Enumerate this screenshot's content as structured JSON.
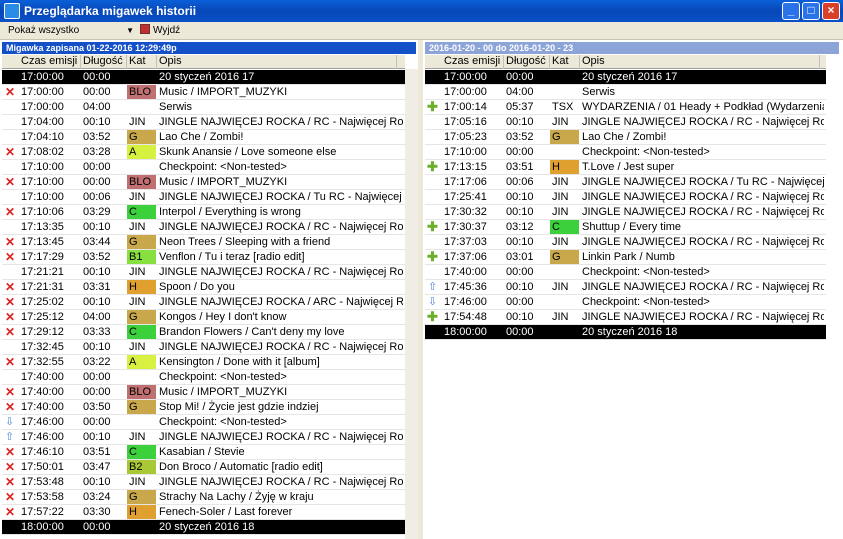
{
  "window": {
    "title": "Przeglądarka migawek historii"
  },
  "toolbar": {
    "filter_value": "Pokaż wszystko",
    "exit_label": "Wyjdź"
  },
  "left": {
    "header": "Migawka zapisana 01-22-2016 12:29:49p",
    "columns": [
      "Czas emisji",
      "Długość",
      "Kat",
      "Opis"
    ],
    "rows": [
      {
        "icon": "",
        "time": "17:00:00",
        "dur": "00:00",
        "cat": "",
        "desc": "20 styczeń 2016 17",
        "dark": true
      },
      {
        "icon": "cross",
        "time": "17:00:00",
        "dur": "00:00",
        "cat": "BLO",
        "catColor": "#c07070",
        "desc": "Music / IMPORT_MUZYKI"
      },
      {
        "icon": "",
        "time": "17:00:00",
        "dur": "04:00",
        "cat": "",
        "desc": "Serwis"
      },
      {
        "icon": "",
        "time": "17:04:00",
        "dur": "00:10",
        "cat": "JIN",
        "desc": "JINGLE NAJWIĘCEJ ROCKA / RC - Najwięcej Rocka w"
      },
      {
        "icon": "",
        "time": "17:04:10",
        "dur": "03:52",
        "cat": "G",
        "catColor": "#c8a84a",
        "desc": "Lao Che / Zombi!"
      },
      {
        "icon": "cross",
        "time": "17:08:02",
        "dur": "03:28",
        "cat": "A",
        "catColor": "#d8f040",
        "desc": "Skunk Anansie / Love someone else"
      },
      {
        "icon": "",
        "time": "17:10:00",
        "dur": "00:00",
        "cat": "",
        "desc": "Checkpoint: <Non-tested>"
      },
      {
        "icon": "cross",
        "time": "17:10:00",
        "dur": "00:00",
        "cat": "BLO",
        "catColor": "#c07070",
        "desc": "Music / IMPORT_MUZYKI"
      },
      {
        "icon": "",
        "time": "17:10:00",
        "dur": "00:06",
        "cat": "JIN",
        "desc": "JINGLE NAJWIĘCEJ ROCKA / Tu RC - Najwięcej Rock"
      },
      {
        "icon": "cross",
        "time": "17:10:06",
        "dur": "03:29",
        "cat": "C",
        "catColor": "#3cd03c",
        "desc": "Interpol / Everything is wrong"
      },
      {
        "icon": "",
        "time": "17:13:35",
        "dur": "00:10",
        "cat": "JIN",
        "desc": "JINGLE NAJWIĘCEJ ROCKA / RC - Najwięcej Rocka w"
      },
      {
        "icon": "cross",
        "time": "17:13:45",
        "dur": "03:44",
        "cat": "G",
        "catColor": "#c8a84a",
        "desc": "Neon Trees / Sleeping with a friend"
      },
      {
        "icon": "cross",
        "time": "17:17:29",
        "dur": "03:52",
        "cat": "B1",
        "catColor": "#88e040",
        "desc": "Venflon / Tu i teraz [radio edit]"
      },
      {
        "icon": "",
        "time": "17:21:21",
        "dur": "00:10",
        "cat": "JIN",
        "desc": "JINGLE NAJWIĘCEJ ROCKA / RC - Najwięcej Rocka w"
      },
      {
        "icon": "cross",
        "time": "17:21:31",
        "dur": "03:31",
        "cat": "H",
        "catColor": "#e0a030",
        "desc": "Spoon / Do you"
      },
      {
        "icon": "cross",
        "time": "17:25:02",
        "dur": "00:10",
        "cat": "JIN",
        "desc": "JINGLE NAJWIĘCEJ ROCKA / ARC - Najwięcej Rocka"
      },
      {
        "icon": "cross",
        "time": "17:25:12",
        "dur": "04:00",
        "cat": "G",
        "catColor": "#c8a84a",
        "desc": "Kongos / Hey I don't know"
      },
      {
        "icon": "cross",
        "time": "17:29:12",
        "dur": "03:33",
        "cat": "C",
        "catColor": "#3cd03c",
        "desc": "Brandon Flowers / Can't deny my love"
      },
      {
        "icon": "",
        "time": "17:32:45",
        "dur": "00:10",
        "cat": "JIN",
        "desc": "JINGLE NAJWIĘCEJ ROCKA / RC - Najwięcej Rocka w"
      },
      {
        "icon": "cross",
        "time": "17:32:55",
        "dur": "03:22",
        "cat": "A",
        "catColor": "#d8f040",
        "desc": "Kensington / Done with it [album]"
      },
      {
        "icon": "",
        "time": "17:40:00",
        "dur": "00:00",
        "cat": "",
        "desc": "Checkpoint: <Non-tested>"
      },
      {
        "icon": "cross",
        "time": "17:40:00",
        "dur": "00:00",
        "cat": "BLO",
        "catColor": "#c07070",
        "desc": "Music / IMPORT_MUZYKI"
      },
      {
        "icon": "cross",
        "time": "17:40:00",
        "dur": "03:50",
        "cat": "G",
        "catColor": "#c8a84a",
        "desc": "Stop Mi! / Życie jest gdzie indziej"
      },
      {
        "icon": "down",
        "time": "17:46:00",
        "dur": "00:00",
        "cat": "",
        "desc": "Checkpoint: <Non-tested>"
      },
      {
        "icon": "up",
        "time": "17:46:00",
        "dur": "00:10",
        "cat": "JIN",
        "desc": "JINGLE NAJWIĘCEJ ROCKA / RC - Najwięcej Rocka w"
      },
      {
        "icon": "cross",
        "time": "17:46:10",
        "dur": "03:51",
        "cat": "C",
        "catColor": "#3cd03c",
        "desc": "Kasabian / Stevie"
      },
      {
        "icon": "cross",
        "time": "17:50:01",
        "dur": "03:47",
        "cat": "B2",
        "catColor": "#a8c838",
        "desc": "Don Broco / Automatic [radio edit]"
      },
      {
        "icon": "cross",
        "time": "17:53:48",
        "dur": "00:10",
        "cat": "JIN",
        "desc": "JINGLE NAJWIĘCEJ ROCKA / RC - Najwięcej Rocka w"
      },
      {
        "icon": "cross",
        "time": "17:53:58",
        "dur": "03:24",
        "cat": "G",
        "catColor": "#c8a84a",
        "desc": "Strachy Na Lachy / Żyję w kraju"
      },
      {
        "icon": "cross",
        "time": "17:57:22",
        "dur": "03:30",
        "cat": "H",
        "catColor": "#e0a030",
        "desc": "Fenech-Soler / Last forever"
      },
      {
        "icon": "",
        "time": "18:00:00",
        "dur": "00:00",
        "cat": "",
        "desc": "20 styczeń 2016 18",
        "dark": true
      }
    ]
  },
  "right": {
    "header": "2016-01-20 - 00 do 2016-01-20 - 23",
    "columns": [
      "Czas emisji",
      "Długość",
      "Kat",
      "Opis"
    ],
    "rows": [
      {
        "icon": "",
        "time": "17:00:00",
        "dur": "00:00",
        "cat": "",
        "desc": "20 styczeń 2016 17",
        "dark": true
      },
      {
        "icon": "",
        "time": "17:00:00",
        "dur": "04:00",
        "cat": "",
        "desc": "Serwis"
      },
      {
        "icon": "plus",
        "time": "17:00:14",
        "dur": "05:37",
        "cat": "TSX",
        "desc": "WYDARZENIA / 01 Heady + Podkład (Wydarzenia)"
      },
      {
        "icon": "",
        "time": "17:05:16",
        "dur": "00:10",
        "cat": "JIN",
        "desc": "JINGLE NAJWIĘCEJ ROCKA / RC - Najwięcej Rocka w"
      },
      {
        "icon": "",
        "time": "17:05:23",
        "dur": "03:52",
        "cat": "G",
        "catColor": "#c8a84a",
        "desc": "Lao Che / Zombi!"
      },
      {
        "icon": "",
        "time": "17:10:00",
        "dur": "00:00",
        "cat": "",
        "desc": "Checkpoint: <Non-tested>"
      },
      {
        "icon": "plus",
        "time": "17:13:15",
        "dur": "03:51",
        "cat": "H",
        "catColor": "#e0a030",
        "desc": "T.Love / Jest super"
      },
      {
        "icon": "",
        "time": "17:17:06",
        "dur": "00:06",
        "cat": "JIN",
        "desc": "JINGLE NAJWIĘCEJ ROCKA / Tu RC - Najwięcej Rock"
      },
      {
        "icon": "",
        "time": "17:25:41",
        "dur": "00:10",
        "cat": "JIN",
        "desc": "JINGLE NAJWIĘCEJ ROCKA / RC - Najwięcej Rocka w"
      },
      {
        "icon": "",
        "time": "17:30:32",
        "dur": "00:10",
        "cat": "JIN",
        "desc": "JINGLE NAJWIĘCEJ ROCKA / RC - Najwięcej Rocka w"
      },
      {
        "icon": "plus",
        "time": "17:30:37",
        "dur": "03:12",
        "cat": "C",
        "catColor": "#3cd03c",
        "desc": "Shuttup / Every time"
      },
      {
        "icon": "",
        "time": "17:37:03",
        "dur": "00:10",
        "cat": "JIN",
        "desc": "JINGLE NAJWIĘCEJ ROCKA / RC - Najwięcej Rocka w"
      },
      {
        "icon": "plus",
        "time": "17:37:06",
        "dur": "03:01",
        "cat": "G",
        "catColor": "#c8a84a",
        "desc": "Linkin Park / Numb"
      },
      {
        "icon": "",
        "time": "17:40:00",
        "dur": "00:00",
        "cat": "",
        "desc": "Checkpoint: <Non-tested>"
      },
      {
        "icon": "up",
        "time": "17:45:36",
        "dur": "00:10",
        "cat": "JIN",
        "desc": "JINGLE NAJWIĘCEJ ROCKA / RC - Najwięcej Rocka w"
      },
      {
        "icon": "down",
        "time": "17:46:00",
        "dur": "00:00",
        "cat": "",
        "desc": "Checkpoint: <Non-tested>"
      },
      {
        "icon": "plus",
        "time": "17:54:48",
        "dur": "00:10",
        "cat": "JIN",
        "desc": "JINGLE NAJWIĘCEJ ROCKA / RC - Najwięcej Rocka w"
      },
      {
        "icon": "",
        "time": "18:00:00",
        "dur": "00:00",
        "cat": "",
        "desc": "20 styczeń 2016 18",
        "dark": true
      }
    ]
  }
}
